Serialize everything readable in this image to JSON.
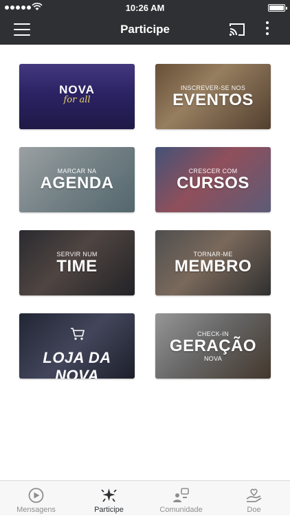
{
  "status_bar": {
    "time": "10:26 AM"
  },
  "header": {
    "title": "Participe"
  },
  "cards": [
    {
      "logo_top": "NOVA",
      "logo_bottom": "for all"
    },
    {
      "pre": "INSCREVER-SE NOS",
      "big": "EVENTOS"
    },
    {
      "pre": "MARCAR NA",
      "big": "AGENDA"
    },
    {
      "pre": "CRESCER COM",
      "big": "CURSOS"
    },
    {
      "pre": "SERVIR NUM",
      "big": "TIME"
    },
    {
      "pre": "TORNAR-ME",
      "big": "MEMBRO"
    },
    {
      "big": "LOJA DA NOVA",
      "icon": "cart-icon"
    },
    {
      "pre": "CHECK-IN",
      "big": "GERAÇÃO",
      "post": "NOVA"
    }
  ],
  "tabs": [
    {
      "label": "Mensagens",
      "icon": "play-circle-icon"
    },
    {
      "label": "Participe",
      "icon": "sparkle-hands-icon",
      "active": true
    },
    {
      "label": "Comunidade",
      "icon": "people-icon"
    },
    {
      "label": "Doe",
      "icon": "heart-hand-icon"
    }
  ],
  "colors": {
    "bar": "#2e3033",
    "accent": "#e8d36a",
    "tab_inactive": "#8e8e8e"
  }
}
